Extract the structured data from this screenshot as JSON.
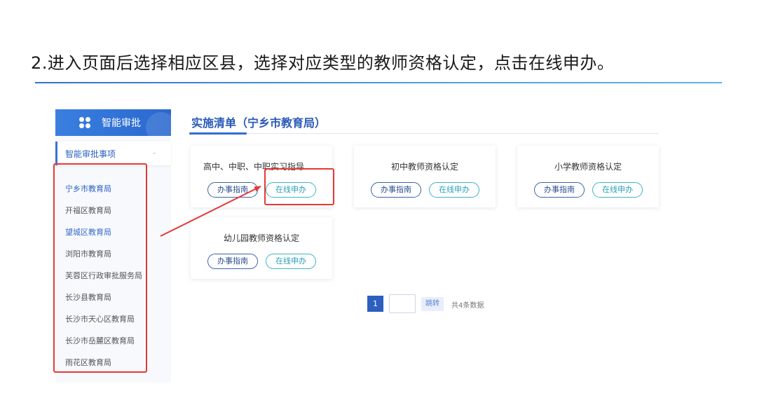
{
  "slide": {
    "title": "2.进入页面后选择相应区县，选择对应类型的教师资格认定，点击在线申办。"
  },
  "sidebar": {
    "header": "智能审批",
    "section": "智能审批事项",
    "items": [
      "宁乡市教育局",
      "开福区教育局",
      "望城区教育局",
      "浏阳市教育局",
      "芙蓉区行政审批服务局",
      "长沙县教育局",
      "长沙市天心区教育局",
      "长沙市岳麓区教育局",
      "雨花区教育局"
    ]
  },
  "main": {
    "title": "实施清单（宁乡市教育局）",
    "cards": [
      {
        "title": "高中、中职、中职实习指导教…",
        "guide": "办事指南",
        "apply": "在线申办"
      },
      {
        "title": "初中教师资格认定",
        "guide": "办事指南",
        "apply": "在线申办"
      },
      {
        "title": "小学教师资格认定",
        "guide": "办事指南",
        "apply": "在线申办"
      },
      {
        "title": "幼儿园教师资格认定",
        "guide": "办事指南",
        "apply": "在线申办"
      }
    ]
  },
  "pager": {
    "current": "1",
    "jump": "跳转",
    "total": "共4条数据"
  },
  "colors": {
    "accent": "#2f6fd1",
    "highlight": "#e53935"
  }
}
